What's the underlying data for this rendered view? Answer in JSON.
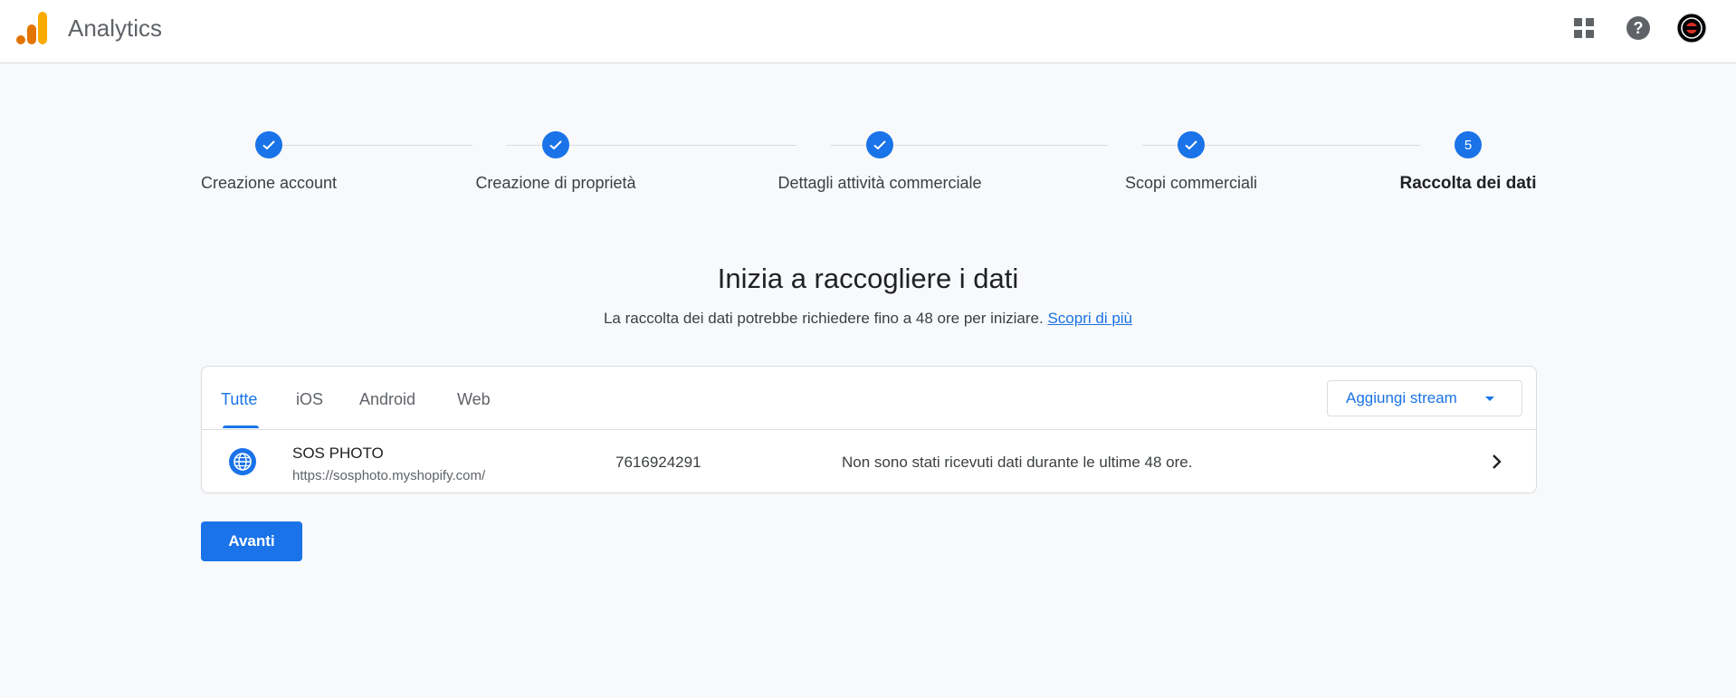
{
  "header": {
    "app_title": "Analytics",
    "icons": [
      "analytics-logo-icon",
      "apps-grid-icon",
      "help-icon",
      "account-avatar"
    ]
  },
  "stepper": {
    "steps": [
      {
        "label": "Creazione account",
        "status": "completed"
      },
      {
        "label": "Creazione di proprietà",
        "status": "completed"
      },
      {
        "label": "Dettagli attività commerciale",
        "status": "completed"
      },
      {
        "label": "Scopi commerciali",
        "status": "completed"
      },
      {
        "label": "Raccolta dei dati",
        "status": "current",
        "number": "5"
      }
    ]
  },
  "main": {
    "title": "Inizia a raccogliere i dati",
    "subtitle": "La raccolta dei dati potrebbe richiedere fino a 48 ore per iniziare.",
    "learn_more": "Scopri di più"
  },
  "streams_card": {
    "tabs": [
      "Tutte",
      "iOS",
      "Android",
      "Web"
    ],
    "active_tab": "Tutte",
    "add_stream_label": "Aggiungi stream",
    "rows": [
      {
        "name": "SOS PHOTO",
        "url": "https://sosphoto.myshopify.com/",
        "id": "7616924291",
        "status": "Non sono stati ricevuti dati durante le ultime 48 ore."
      }
    ]
  },
  "actions": {
    "next_label": "Avanti"
  },
  "colors": {
    "accent": "#1a73e8",
    "background": "#f8f9fa",
    "logo_orange": "#f9ab00",
    "logo_dark_orange": "#e37400"
  }
}
